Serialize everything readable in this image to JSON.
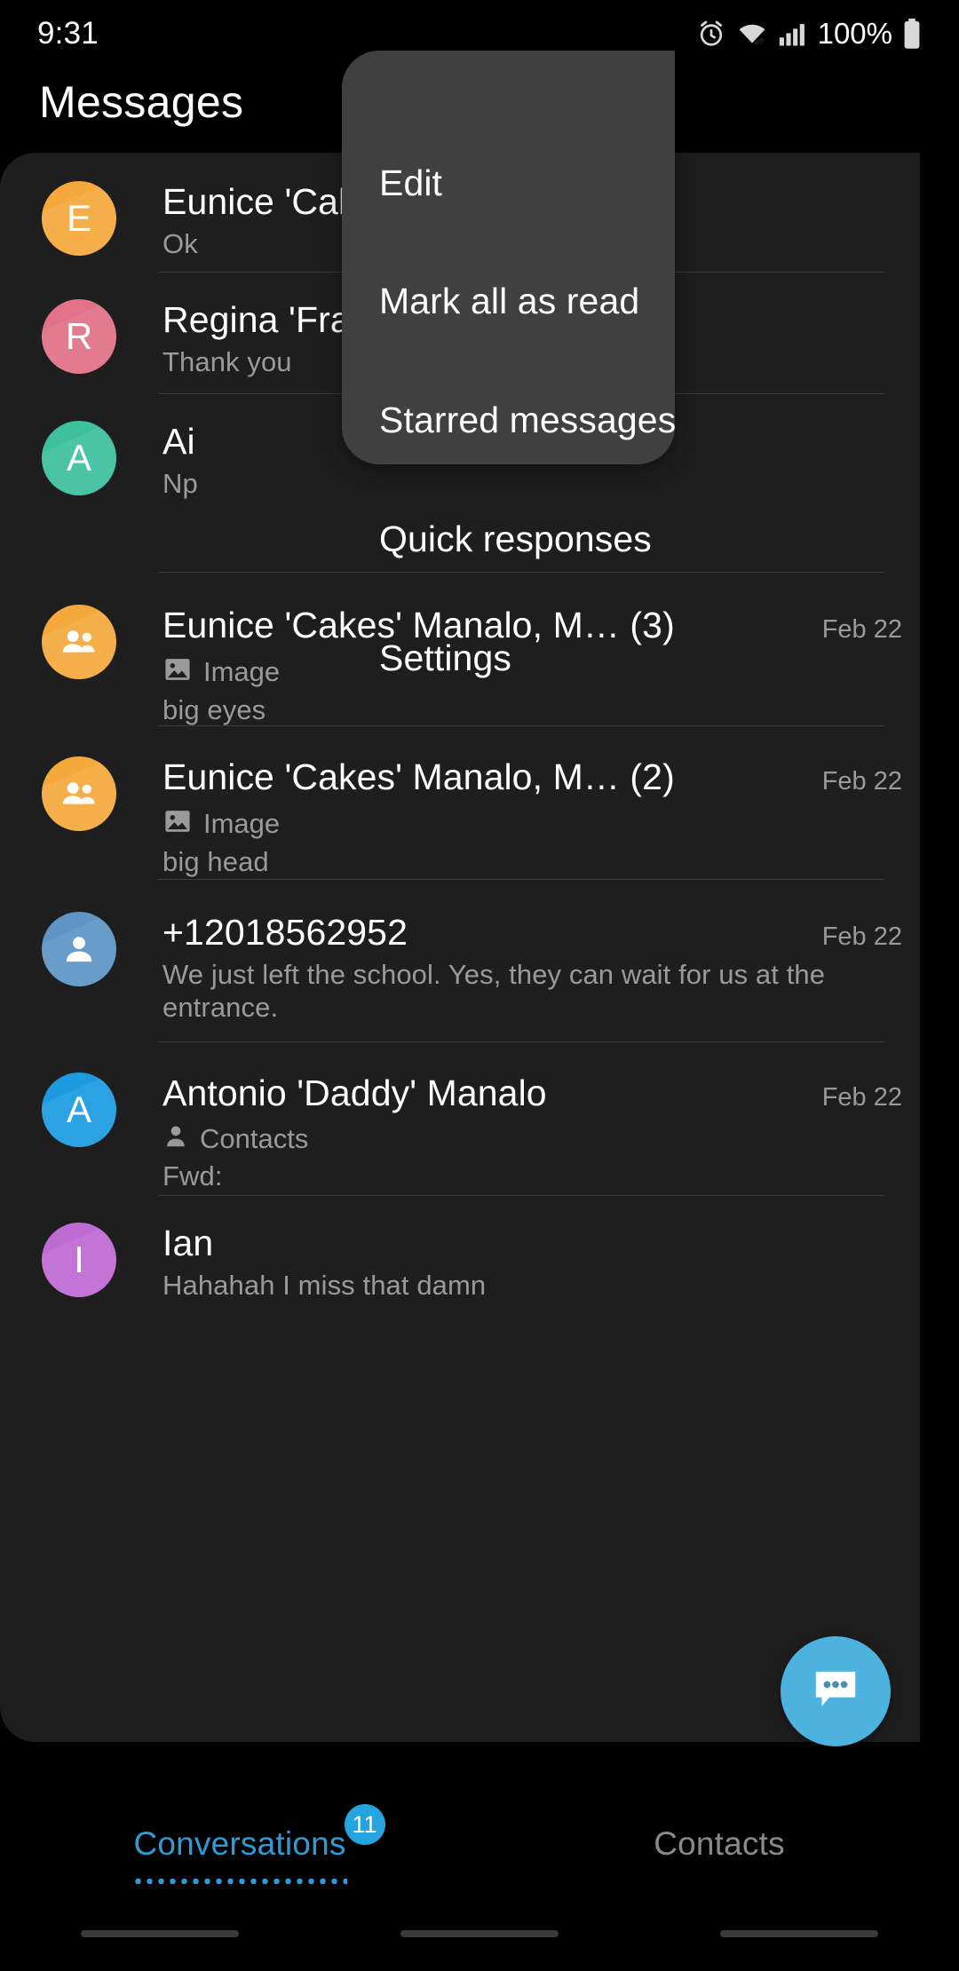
{
  "status_bar": {
    "time": "9:31",
    "battery_percent": "100%",
    "icons": [
      "alarm-icon",
      "wifi-icon",
      "signal-icon",
      "battery-icon"
    ]
  },
  "header": {
    "title": "Messages"
  },
  "overflow_menu": {
    "items": [
      {
        "label": "Edit"
      },
      {
        "label": "Mark all as read"
      },
      {
        "label": "Starred messages"
      },
      {
        "label": "Quick responses"
      },
      {
        "label": "Settings"
      }
    ],
    "background_color": "#404040"
  },
  "conversations": [
    {
      "avatar_letter": "E",
      "avatar_color": "#F5A93D",
      "avatar_type": "letter",
      "name": "Eunice 'Cakes'",
      "preview": "Ok",
      "date": "",
      "attachment": null
    },
    {
      "avatar_letter": "R",
      "avatar_color": "#E17287",
      "avatar_type": "letter",
      "name": "Regina 'Fravrite'",
      "preview": "Thank you",
      "date": "",
      "attachment": null
    },
    {
      "avatar_letter": "A",
      "avatar_color": "#3EBFA0",
      "avatar_type": "letter",
      "name": "Ai",
      "preview": "Np",
      "date": "",
      "attachment": null
    },
    {
      "avatar_letter": "",
      "avatar_color": "#F5A93D",
      "avatar_type": "group",
      "name": "Eunice 'Cakes' Manalo, M… (3)",
      "preview": "big eyes",
      "date": "Feb 22",
      "attachment": {
        "icon": "image-icon",
        "label": "Image"
      }
    },
    {
      "avatar_letter": "",
      "avatar_color": "#F5A93D",
      "avatar_type": "group",
      "name": "Eunice 'Cakes' Manalo, M… (2)",
      "preview": "big head",
      "date": "Feb 22",
      "attachment": {
        "icon": "image-icon",
        "label": "Image"
      }
    },
    {
      "avatar_letter": "",
      "avatar_color": "#5E95C4",
      "avatar_type": "person",
      "name": "+12018562952",
      "preview": "We just left the school. Yes, they can wait for us at the entrance.",
      "date": "Feb 22",
      "attachment": null
    },
    {
      "avatar_letter": "A",
      "avatar_color": "#1E9BE0",
      "avatar_type": "letter",
      "name": "Antonio 'Daddy' Manalo",
      "preview": "Fwd:",
      "date": "Feb 22",
      "attachment": {
        "icon": "contact-icon",
        "label": "Contacts"
      }
    },
    {
      "avatar_letter": "I",
      "avatar_color": "#BE6BD4",
      "avatar_type": "letter",
      "name": "Ian",
      "preview": "Hahahah I miss that damn",
      "date": "",
      "attachment": null
    }
  ],
  "fab": {
    "icon": "new-message-icon",
    "color": "#4DB2DD"
  },
  "bottom_nav": {
    "tabs": [
      {
        "label": "Conversations",
        "badge": "11",
        "active": true
      },
      {
        "label": "Contacts",
        "badge": "",
        "active": false
      }
    ],
    "active_color": "#2E9BD6",
    "inactive_color": "#8a8a8a"
  }
}
